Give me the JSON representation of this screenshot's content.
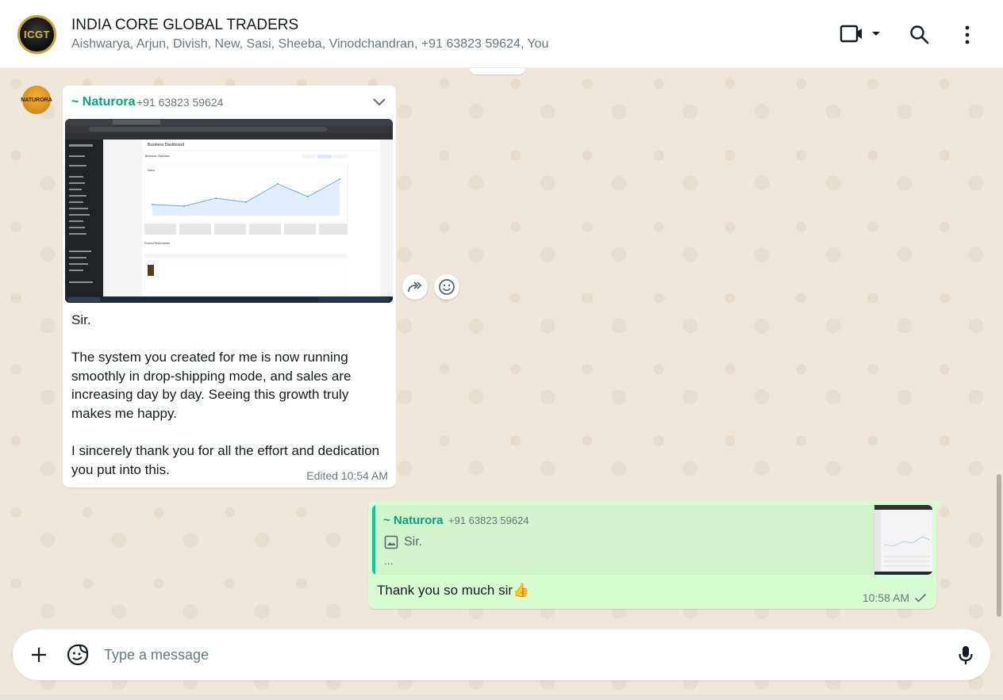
{
  "header": {
    "avatar_text": "ICGT",
    "title": "INDIA CORE GLOBAL TRADERS",
    "members": "Aishwarya, Arjun, Divish, New, Sasi, Sheeba, Vinodchandran, +91 63823 59624, You"
  },
  "incoming": {
    "avatar_text": "NATURORA",
    "sender_name": "~ Naturora",
    "sender_phone": "+91 63823 59624",
    "text": "Sir.\n\nThe system you created for me is now running smoothly in drop-shipping mode, and sales are increasing day by day. Seeing this growth truly makes me happy.\n\nI sincerely thank you for all the effort and dedication you put into this.",
    "meta": "Edited 10:54 AM",
    "screenshot": {
      "dashboard_title": "Business Dashboard",
      "section": "Business Overview",
      "chart_label": "Sales",
      "products_label": "Product Performance"
    }
  },
  "outgoing": {
    "quote_name": "~ Naturora",
    "quote_phone": "+91 63823 59624",
    "quote_text": "Sir.",
    "quote_more": "...",
    "text": "Thank you so much sir👍",
    "time": "10:58 AM"
  },
  "composer": {
    "placeholder": "Type a message"
  },
  "colors": {
    "accent": "#06a17d",
    "outgoing_bubble": "#d9fdd3",
    "quote_bar": "#06cf9c"
  }
}
